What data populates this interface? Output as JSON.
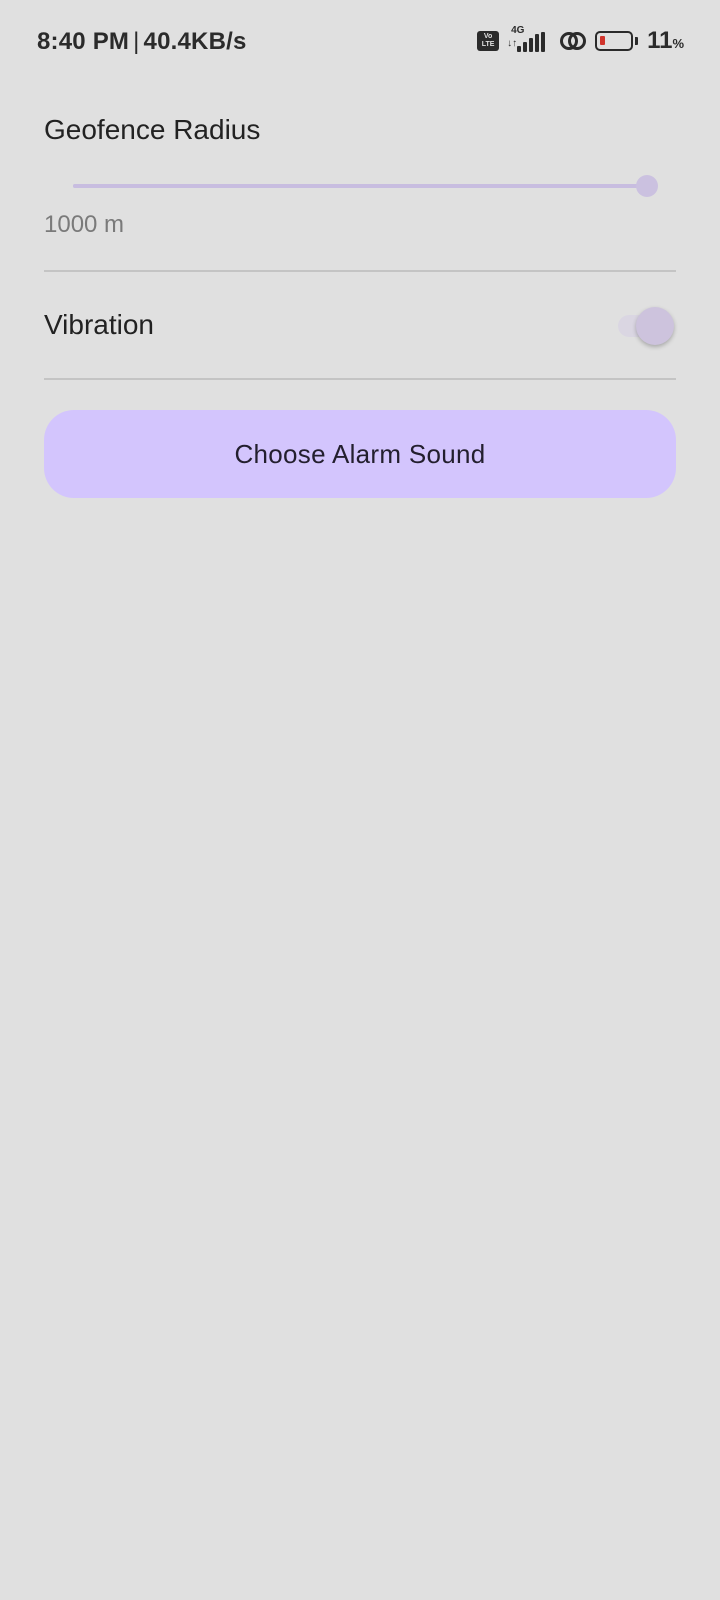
{
  "status_bar": {
    "time": "8:40 PM",
    "separator": "|",
    "net_speed": "40.4KB/s",
    "volte_top": "Vo",
    "volte_bottom": "LTE",
    "network_type": "4G",
    "signal_arrows": "↓↑",
    "battery_percent": "11",
    "battery_unit": "%",
    "icons": [
      "volte-icon",
      "signal-4g-icon",
      "link-icon",
      "battery-icon"
    ],
    "battery_level": 0.11,
    "battery_low_color": "#d0342c"
  },
  "settings": {
    "geofence": {
      "title": "Geofence Radius",
      "value_text": "1000 m",
      "slider_fraction": 1.0
    },
    "vibration": {
      "label": "Vibration",
      "enabled": true
    },
    "alarm_button": {
      "label": "Choose Alarm Sound"
    }
  },
  "colors": {
    "background": "#e0e0e0",
    "accent": "#d3c5fd",
    "slider": "#c8bde0"
  }
}
